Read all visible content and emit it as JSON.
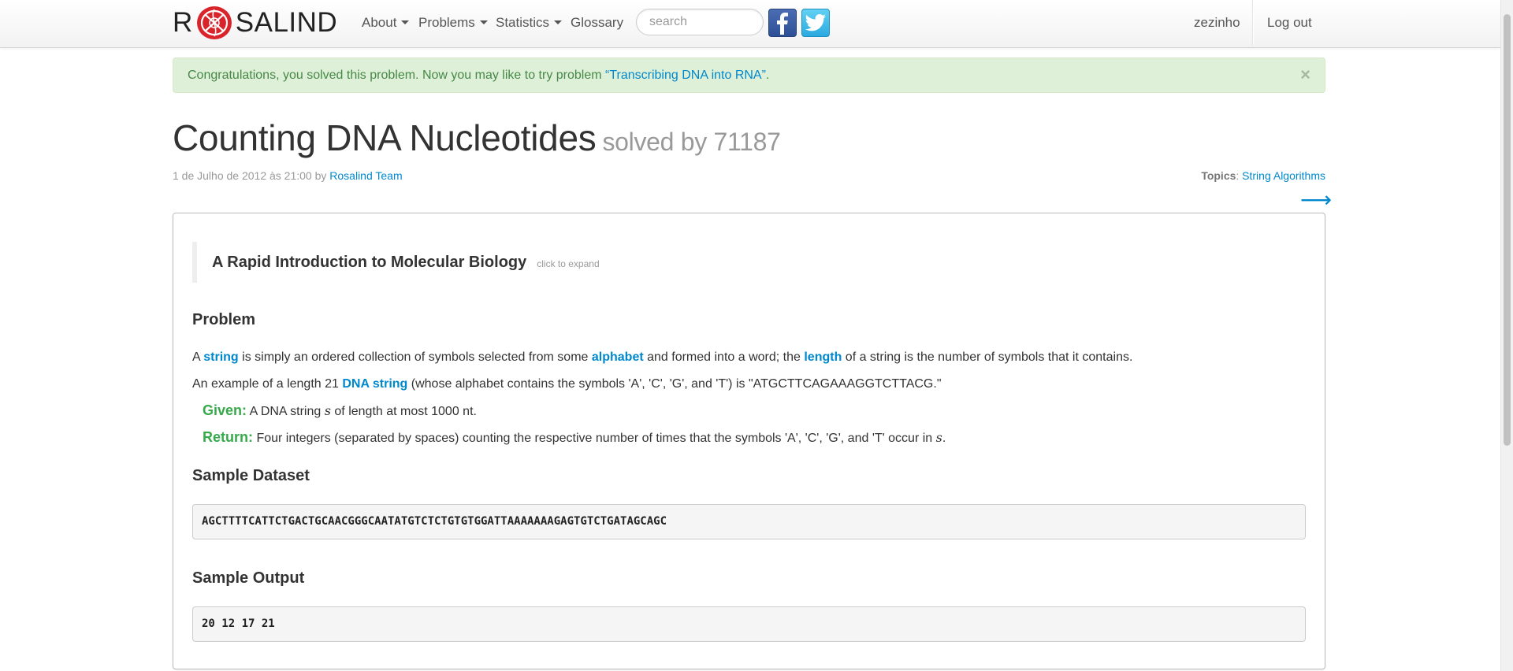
{
  "navbar": {
    "brand_left": "R",
    "brand_right": "SALIND",
    "menu": [
      {
        "label": "About",
        "dropdown": true
      },
      {
        "label": "Problems",
        "dropdown": true
      },
      {
        "label": "Statistics",
        "dropdown": true
      },
      {
        "label": "Glossary",
        "dropdown": false
      }
    ],
    "search_placeholder": "search",
    "social": {
      "facebook_icon": "facebook-icon",
      "twitter_icon": "twitter-icon"
    },
    "user": "zezinho",
    "logout": "Log out"
  },
  "alert": {
    "text": "Congratulations, you solved this problem. Now you may like to try problem ",
    "link": "“Transcribing DNA into RNA”",
    "end": ".",
    "close": "×"
  },
  "problem": {
    "title": "Counting DNA Nucleotides",
    "solved_by": "solved by 71187",
    "date": "1 de Julho de 2012 às 21:00",
    "by_text": " by ",
    "author": "Rosalind Team",
    "topics_label": "Topics",
    "topic": "String Algorithms",
    "next_arrow": "⟶",
    "intro_title": "A Rapid Introduction to Molecular Biology",
    "intro_expand": "click to expand",
    "problem_heading": "Problem",
    "p1": {
      "a": "A ",
      "l1": "string",
      "b": " is simply an ordered collection of symbols selected from some ",
      "l2": "alphabet",
      "c": " and formed into a word; the ",
      "l3": "length",
      "d": " of a string is the number of symbols that it contains."
    },
    "p2": {
      "a": "An example of a length 21 ",
      "l1": "DNA string",
      "b": " (whose alphabet contains the symbols 'A', 'C', 'G', and 'T') is \"ATGCTTCAGAAAGGTCTTACG.\""
    },
    "given": {
      "label": "Given:",
      "a": " A DNA string ",
      "var": "s",
      "b": " of length at most 1000 nt."
    },
    "return": {
      "label": "Return:",
      "a": " Four integers (separated by spaces) counting the respective number of times that the symbols 'A', 'C', 'G', and 'T' occur in ",
      "var": "s",
      "b": "."
    },
    "sample_dataset_heading": "Sample Dataset",
    "sample_dataset": "AGCTTTTCATTCTGACTGCAACGGGCAATATGTCTCTGTGTGGATTAAAAAAAGAGTGTCTGATAGCAGC",
    "sample_output_heading": "Sample Output",
    "sample_output": "20 12 17 21"
  },
  "colors": {
    "link": "#0088cc",
    "alert_bg": "#dff0d8",
    "alert_text": "#468847",
    "given_label": "#36a94a",
    "logo_red": "#d9242b"
  }
}
